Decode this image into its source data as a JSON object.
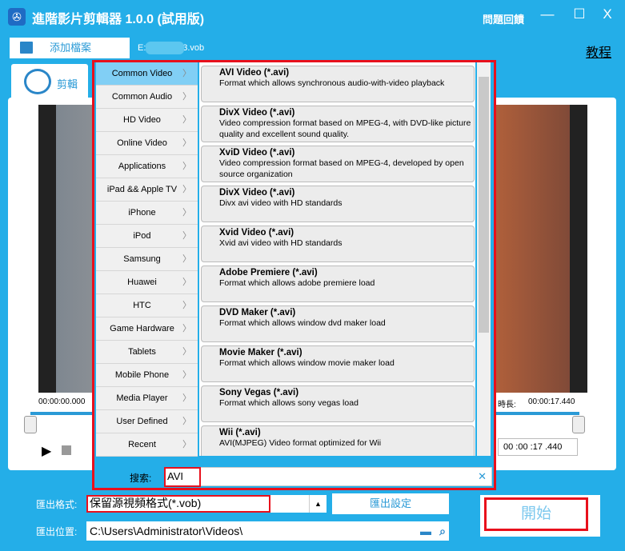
{
  "window": {
    "title": "進階影片剪輯器 1.0.0 (試用版)",
    "feedback": "問題回饋",
    "minimize": "—",
    "maximize": "☐",
    "close": "X"
  },
  "toolbar": {
    "add_file": "添加檔案",
    "file_path": "E:\\reneelab3.vob",
    "tutorial": "教程"
  },
  "tab": {
    "label": "剪輯"
  },
  "player": {
    "start_time": "00:00:00.000",
    "duration_label": "時長:",
    "duration": "00:00:17.440",
    "end_spin": "00 :00 :17 .440"
  },
  "popup": {
    "categories": [
      "Common Video",
      "Common Audio",
      "HD Video",
      "Online Video",
      "Applications",
      "iPad && Apple TV",
      "iPhone",
      "iPod",
      "Samsung",
      "Huawei",
      "HTC",
      "Game Hardware",
      "Tablets",
      "Mobile Phone",
      "Media Player",
      "User Defined",
      "Recent"
    ],
    "active_category": "Common Video",
    "formats": [
      {
        "name": "AVI Video (*.avi)",
        "desc": "Format which allows synchronous audio-with-video playback"
      },
      {
        "name": "DivX Video (*.avi)",
        "desc": "Video compression format based on MPEG-4, with DVD-like picture quality and excellent sound quality."
      },
      {
        "name": "XviD Video (*.avi)",
        "desc": "Video compression format based on MPEG-4, developed by open source organization"
      },
      {
        "name": "DivX Video (*.avi)",
        "desc": "Divx avi video with HD standards"
      },
      {
        "name": "Xvid Video (*.avi)",
        "desc": "Xvid avi video with HD standards"
      },
      {
        "name": "Adobe Premiere (*.avi)",
        "desc": "Format which allows adobe premiere load"
      },
      {
        "name": "DVD Maker (*.avi)",
        "desc": "Format which allows window dvd maker load"
      },
      {
        "name": "Movie Maker (*.avi)",
        "desc": "Format which allows window movie maker load"
      },
      {
        "name": "Sony Vegas (*.avi)",
        "desc": "Format which allows sony vegas load"
      },
      {
        "name": "Wii (*.avi)",
        "desc": "AVI(MJPEG) Video format optimized for Wii"
      }
    ],
    "search_label": "搜索:",
    "search_value": "AVI"
  },
  "export": {
    "format_label": "匯出格式:",
    "format_value": "保留源視頻格式(*.vob)",
    "settings": "匯出設定",
    "location_label": "匯出位置:",
    "location_value": "C:\\Users\\Administrator\\Videos\\",
    "start": "開始"
  },
  "colors": {
    "accent": "#24aee8",
    "highlight": "#e8101c"
  }
}
